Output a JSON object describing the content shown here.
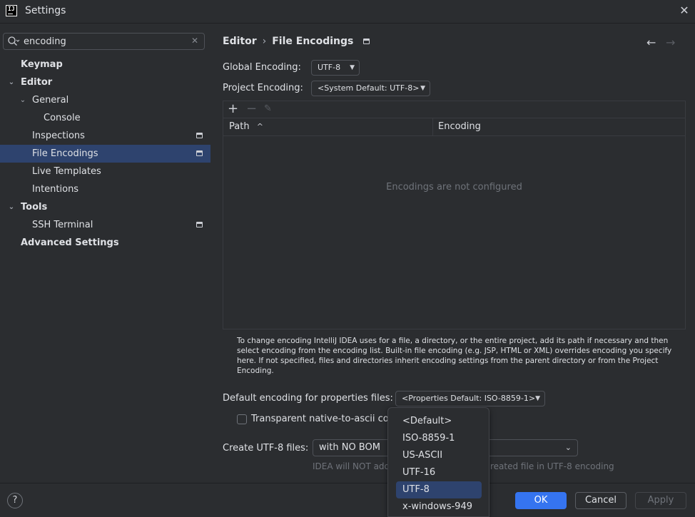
{
  "window": {
    "title": "Settings",
    "logo_text": "IJ"
  },
  "search": {
    "value": "encoding",
    "placeholder": ""
  },
  "sidebar": {
    "items": [
      {
        "label": "Keymap"
      },
      {
        "label": "Editor"
      },
      {
        "label": "General"
      },
      {
        "label": "Console"
      },
      {
        "label": "Inspections"
      },
      {
        "label": "File Encodings"
      },
      {
        "label": "Live Templates"
      },
      {
        "label": "Intentions"
      },
      {
        "label": "Tools"
      },
      {
        "label": "SSH Terminal"
      },
      {
        "label": "Advanced Settings"
      }
    ]
  },
  "breadcrumb": {
    "parent": "Editor",
    "separator": "›",
    "current": "File Encodings"
  },
  "global_encoding": {
    "label": "Global Encoding:",
    "value": "UTF-8"
  },
  "project_encoding": {
    "label": "Project Encoding:",
    "value": "<System Default: UTF-8>"
  },
  "table": {
    "columns": [
      "Path",
      "Encoding"
    ],
    "sort_indicator": "^",
    "empty_text": "Encodings are not configured"
  },
  "help_text": "To change encoding IntelliJ IDEA uses for a file, a directory, or the entire project, add its path if necessary and then select encoding from the encoding list. Built-in file encoding (e.g. JSP, HTML or XML) overrides encoding you specify here. If not specified, files and directories inherit encoding settings from the parent directory or from the Project Encoding.",
  "properties": {
    "label": "Default encoding for properties files:",
    "value": "<Properties Default: ISO-8859-1>"
  },
  "transparent": {
    "label": "Transparent native-to-ascii co",
    "checked": false
  },
  "utf8": {
    "label": "Create UTF-8 files:",
    "value": "with NO BOM",
    "hint_left": "IDEA will NOT add",
    "hint_right": "reated file in UTF-8 encoding"
  },
  "dropdown": {
    "options": [
      "<Default>",
      "ISO-8859-1",
      "US-ASCII",
      "UTF-16",
      "UTF-8",
      "x-windows-949"
    ],
    "selected": "UTF-8"
  },
  "footer": {
    "help": "?",
    "ok": "OK",
    "cancel": "Cancel",
    "apply": "Apply"
  },
  "colors": {
    "accent": "#3574f0",
    "selection": "#2e436e",
    "background": "#2b2d30"
  }
}
